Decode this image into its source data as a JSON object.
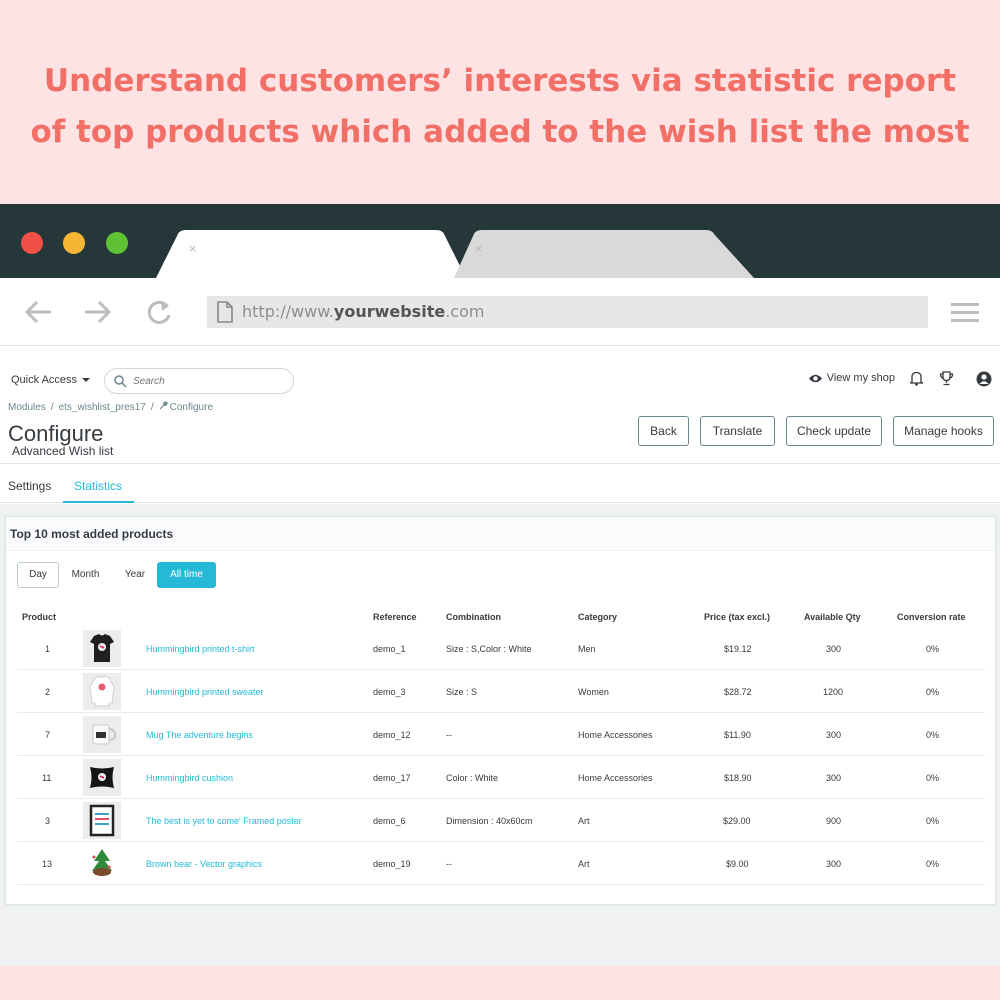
{
  "headline": {
    "line1": "Understand customers’ interests via statistic report",
    "line2": "of top products which added to the wish list the most"
  },
  "browser": {
    "url_prefix": "http://www.",
    "url_domain": "yourwebsite",
    "url_suffix": ".com",
    "tab_close_glyph": "×"
  },
  "admin": {
    "quick_access": "Quick Access",
    "search_placeholder": "Search",
    "view_my_shop": "View my shop",
    "breadcrumb": [
      "Modules",
      "ets_wishlist_pres17",
      "Configure"
    ],
    "page_title": "Configure",
    "page_subtitle": "Advanced Wish list",
    "toolbar": {
      "back": "Back",
      "translate": "Translate",
      "check_update": "Check update",
      "manage_hooks": "Manage hooks"
    },
    "tabs": {
      "settings": "Settings",
      "statistics": "Statistics"
    }
  },
  "panel": {
    "title": "Top 10 most added products",
    "periods": [
      "Day",
      "Month",
      "Year",
      "All time"
    ],
    "active_period": "All time",
    "columns": [
      "Product",
      "Reference",
      "Combination",
      "Category",
      "Price (tax excl.)",
      "Available Qty",
      "Conversion rate"
    ],
    "rows": [
      {
        "id": "1",
        "name": "Hummingbird printed t-shirt",
        "reference": "demo_1",
        "combination": "Size : S,Color : White",
        "category": "Men",
        "price": "$19.12",
        "qty": "300",
        "conversion": "0%"
      },
      {
        "id": "2",
        "name": "Hummingbird printed sweater",
        "reference": "demo_3",
        "combination": "Size : S",
        "category": "Women",
        "price": "$28.72",
        "qty": "1200",
        "conversion": "0%"
      },
      {
        "id": "7",
        "name": "Mug The adventure begins",
        "reference": "demo_12",
        "combination": "--",
        "category": "Home Accessories",
        "price": "$11.90",
        "qty": "300",
        "conversion": "0%"
      },
      {
        "id": "11",
        "name": "Hummingbird cushion",
        "reference": "demo_17",
        "combination": "Color : White",
        "category": "Home Accessories",
        "price": "$18.90",
        "qty": "300",
        "conversion": "0%"
      },
      {
        "id": "3",
        "name": "The best is yet to come' Framed poster",
        "reference": "demo_6",
        "combination": "Dimension : 40x60cm",
        "category": "Art",
        "price": "$29.00",
        "qty": "900",
        "conversion": "0%"
      },
      {
        "id": "13",
        "name": "Brown bear - Vector graphics",
        "reference": "demo_19",
        "combination": "--",
        "category": "Art",
        "price": "$9.00",
        "qty": "300",
        "conversion": "0%"
      }
    ]
  },
  "colors": {
    "accent": "#25b9d7",
    "headline": "#f16f66",
    "page_bg": "#fde3e3",
    "chrome": "#263739"
  }
}
